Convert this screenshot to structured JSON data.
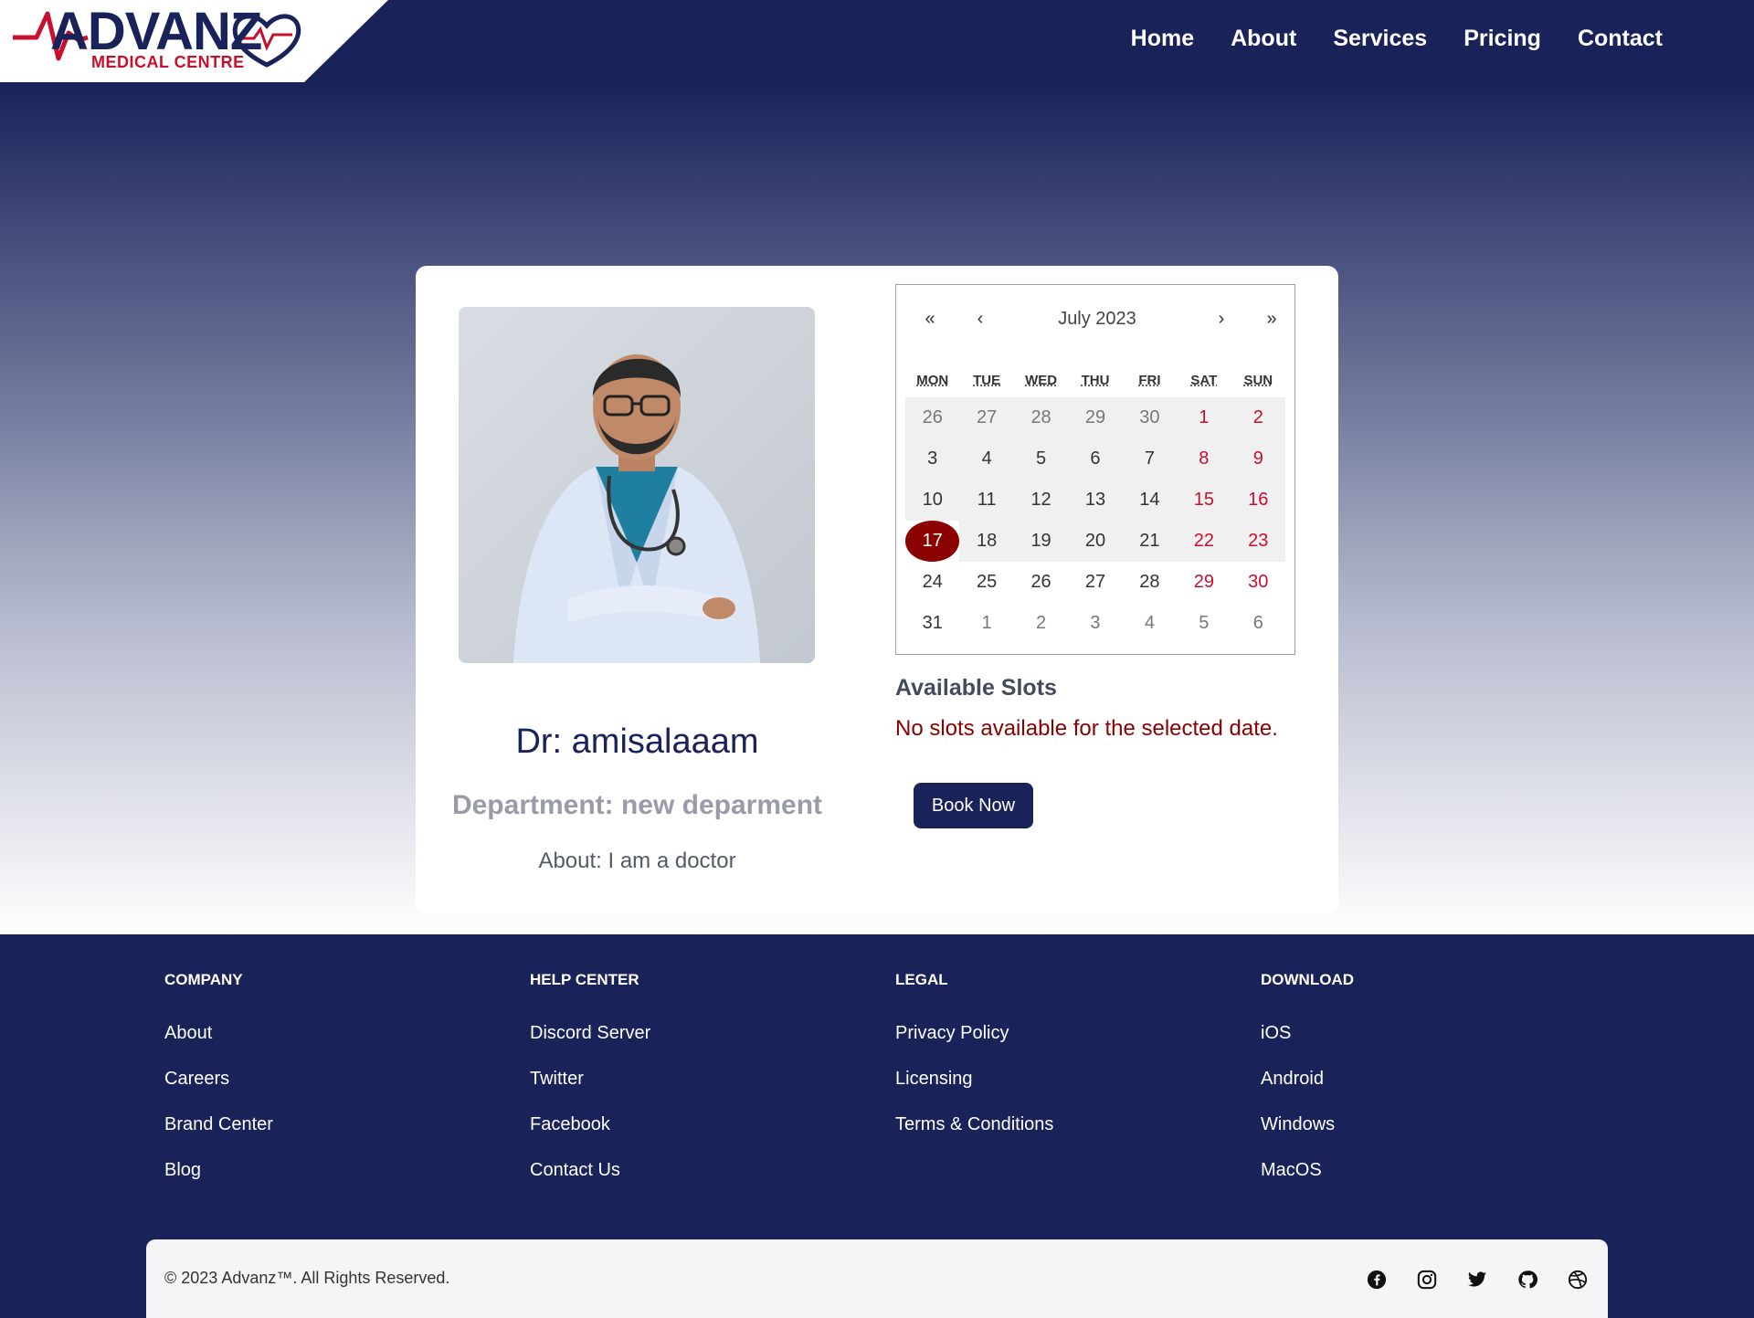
{
  "brand": {
    "name": "ADVANZ",
    "subtitle": "MEDICAL CENTRE",
    "colors": {
      "primary": "#19235a",
      "accent": "#c8102e",
      "selected": "#8b0000"
    }
  },
  "nav": {
    "items": [
      {
        "label": "Home"
      },
      {
        "label": "About"
      },
      {
        "label": "Services"
      },
      {
        "label": "Pricing"
      },
      {
        "label": "Contact"
      }
    ]
  },
  "doctor": {
    "name": "Dr: amisalaaam",
    "department": "Department: new deparment",
    "about": "About: I am a doctor",
    "photo_icon": "doctor-photo"
  },
  "calendar": {
    "month_label": "July 2023",
    "prev_year": "«",
    "prev_month": "‹",
    "next_month": "›",
    "next_year": "»",
    "weekdays": [
      "MON",
      "TUE",
      "WED",
      "THU",
      "FRI",
      "SAT",
      "SUN"
    ],
    "selected_day": "17",
    "weeks": [
      [
        "26",
        "27",
        "28",
        "29",
        "30",
        "1",
        "2"
      ],
      [
        "3",
        "4",
        "5",
        "6",
        "7",
        "8",
        "9"
      ],
      [
        "10",
        "11",
        "12",
        "13",
        "14",
        "15",
        "16"
      ],
      [
        "17",
        "18",
        "19",
        "20",
        "21",
        "22",
        "23"
      ],
      [
        "24",
        "25",
        "26",
        "27",
        "28",
        "29",
        "30"
      ],
      [
        "31",
        "1",
        "2",
        "3",
        "4",
        "5",
        "6"
      ]
    ]
  },
  "slots": {
    "title": "Available Slots",
    "message": "No slots available for the selected date.",
    "book_label": "Book Now"
  },
  "footer": {
    "columns": [
      {
        "title": "COMPANY",
        "links": [
          "About",
          "Careers",
          "Brand Center",
          "Blog"
        ]
      },
      {
        "title": "HELP CENTER",
        "links": [
          "Discord Server",
          "Twitter",
          "Facebook",
          "Contact Us"
        ]
      },
      {
        "title": "LEGAL",
        "links": [
          "Privacy Policy",
          "Licensing",
          "Terms & Conditions"
        ]
      },
      {
        "title": "DOWNLOAD",
        "links": [
          "iOS",
          "Android",
          "Windows",
          "MacOS"
        ]
      }
    ],
    "copyright": "© 2023 Advanz™. All Rights Reserved.",
    "socials": [
      "facebook-icon",
      "instagram-icon",
      "twitter-icon",
      "github-icon",
      "dribbble-icon"
    ]
  }
}
